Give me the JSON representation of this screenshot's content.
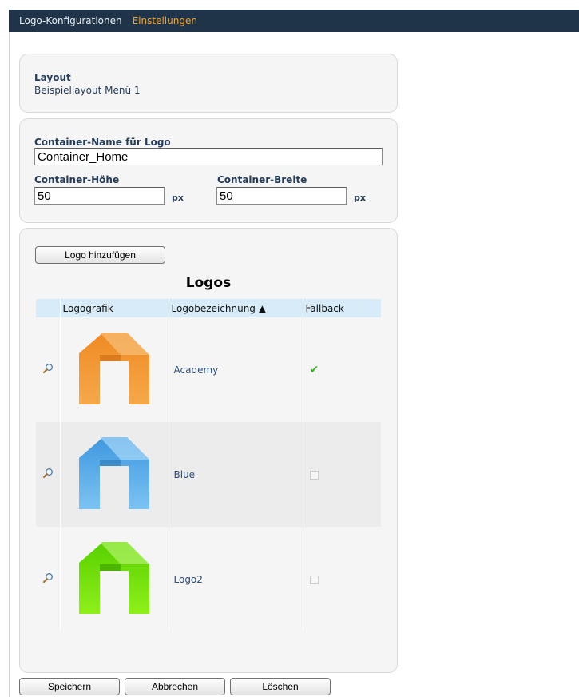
{
  "topbar": {
    "tab_config": "Logo-Konfigurationen",
    "tab_settings": "Einstellungen"
  },
  "layout": {
    "label": "Layout",
    "value": "Beispiellayout Menü 1"
  },
  "container": {
    "name_label": "Container-Name für Logo",
    "name_value": "Container_Home",
    "height_label": "Container-Höhe",
    "height_value": "50",
    "height_unit": "px",
    "width_label": "Container-Breite",
    "width_value": "50",
    "width_unit": "px"
  },
  "logos": {
    "add_button": "Logo hinzufügen",
    "title": "Logos",
    "columns": [
      "",
      "Logografik",
      "Logobezeichnung ▲",
      "Fallback"
    ],
    "rows": [
      {
        "name": "Academy",
        "fallback": true,
        "color_top": "#f08a24",
        "color_bottom": "#f5a94a"
      },
      {
        "name": "Blue",
        "fallback": false,
        "color_top": "#3f98df",
        "color_bottom": "#7cc3f3"
      },
      {
        "name": "Logo2",
        "fallback": false,
        "color_top": "#57d000",
        "color_bottom": "#8ff01a"
      }
    ]
  },
  "footer": {
    "save": "Speichern",
    "cancel": "Abbrechen",
    "delete": "Löschen"
  },
  "colors": {
    "topbar_bg": "#1f3448",
    "active_tab": "#f0a42a",
    "label_text": "#243c5a",
    "header_bg": "#d7ebf8"
  }
}
